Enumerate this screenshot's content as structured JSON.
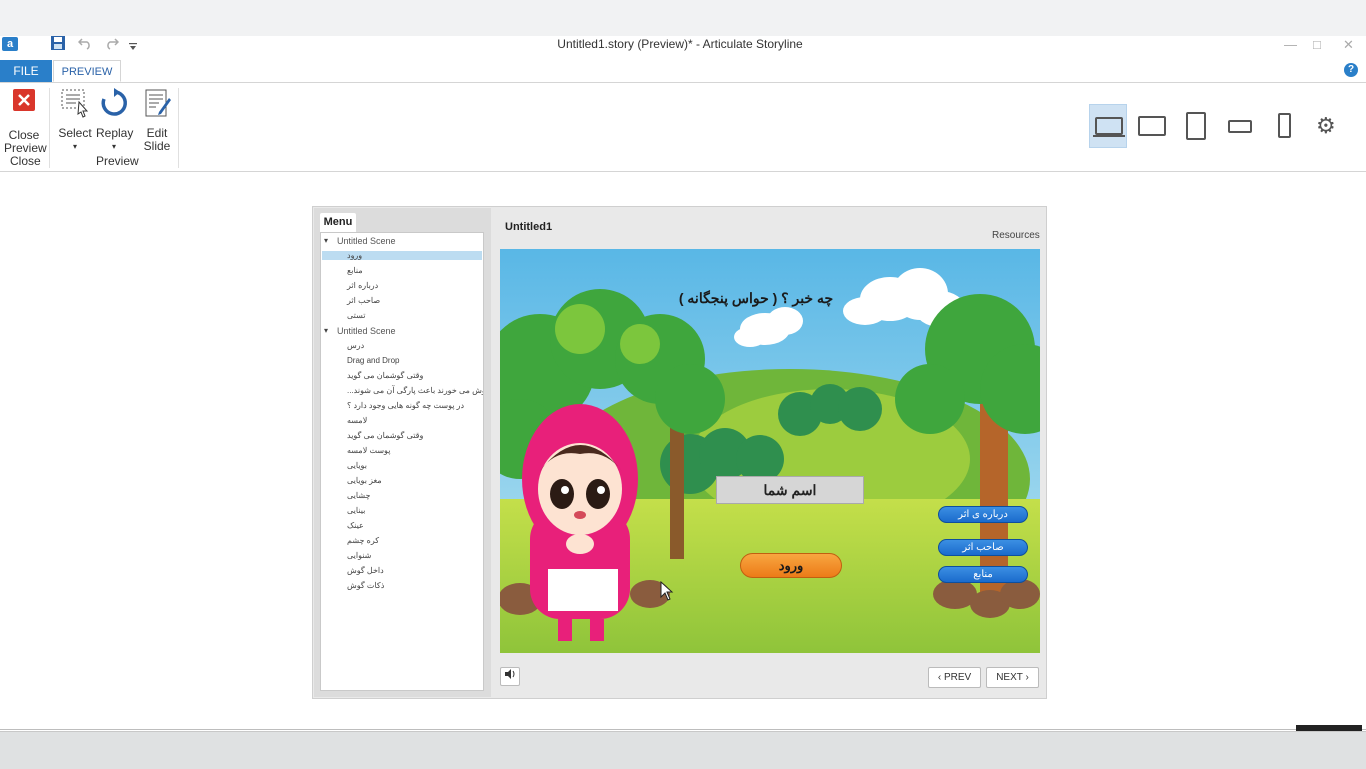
{
  "window": {
    "title": "Untitled1.story (Preview)* -  Articulate Storyline",
    "app_icon_letter": "a"
  },
  "quick_access": {
    "save_icon": "save-icon",
    "undo_icon": "undo-icon",
    "redo_icon": "redo-icon",
    "customize_icon": "dropdown-arrow-icon"
  },
  "ribbon": {
    "tabs": [
      {
        "label": "FILE"
      },
      {
        "label": "PREVIEW"
      }
    ],
    "buttons": {
      "close_preview": {
        "line1": "Close",
        "line2": "Preview"
      },
      "select": {
        "label": "Select"
      },
      "replay": {
        "label": "Replay"
      },
      "edit_slide": {
        "line1": "Edit",
        "line2": "Slide"
      }
    },
    "groups": {
      "close": "Close",
      "preview": "Preview"
    }
  },
  "player": {
    "menu_tab": "Menu",
    "slide_title": "Untitled1",
    "resources": "Resources",
    "menu_items": [
      {
        "label": "Untitled Scene",
        "type": "scene"
      },
      {
        "label": "ورود",
        "type": "slide",
        "selected": true
      },
      {
        "label": "منابع",
        "type": "slide"
      },
      {
        "label": "درباره اثر",
        "type": "slide"
      },
      {
        "label": "صاحب اثر",
        "type": "slide"
      },
      {
        "label": "تستی",
        "type": "slide"
      },
      {
        "label": "Untitled Scene",
        "type": "scene"
      },
      {
        "label": "درس",
        "type": "slide"
      },
      {
        "label": "Drag and Drop",
        "type": "slide"
      },
      {
        "label": "وقتی گوشمان می گوید",
        "type": "slide"
      },
      {
        "label": "...پرده ی گوش می خورند باعث پارگی آن می شوند",
        "type": "slide"
      },
      {
        "label": "در پوست چه گونه هایی وجود دارد ؟",
        "type": "slide"
      },
      {
        "label": "لامسه",
        "type": "slide"
      },
      {
        "label": "وقتی گوشمان می گوید",
        "type": "slide"
      },
      {
        "label": "پوست لامسه",
        "type": "slide"
      },
      {
        "label": "بویایی",
        "type": "slide"
      },
      {
        "label": "مغز بویایی",
        "type": "slide"
      },
      {
        "label": "چشایی",
        "type": "slide"
      },
      {
        "label": "بینایی",
        "type": "slide"
      },
      {
        "label": "عینک",
        "type": "slide"
      },
      {
        "label": "کره چشم",
        "type": "slide"
      },
      {
        "label": "شنوایی",
        "type": "slide"
      },
      {
        "label": "داخل گوش",
        "type": "slide"
      },
      {
        "label": "ذکات گوش",
        "type": "slide"
      }
    ],
    "slide": {
      "heading": "چه خبر ؟ ( حواس پنجگانه )",
      "name_field": "اسم شما",
      "enter_button": "ورود",
      "about_button": "درباره ی اثر",
      "owner_button": "صاحب اثر",
      "sources_button": "منابع"
    },
    "controls": {
      "prev": "PREV",
      "next": "NEXT",
      "volume_icon": "speaker-icon"
    }
  },
  "colors": {
    "accent": "#2a7fc9",
    "enter_button": "#f39a2e",
    "side_buttons": "#1f73d4",
    "character_pink": "#e8207a"
  }
}
